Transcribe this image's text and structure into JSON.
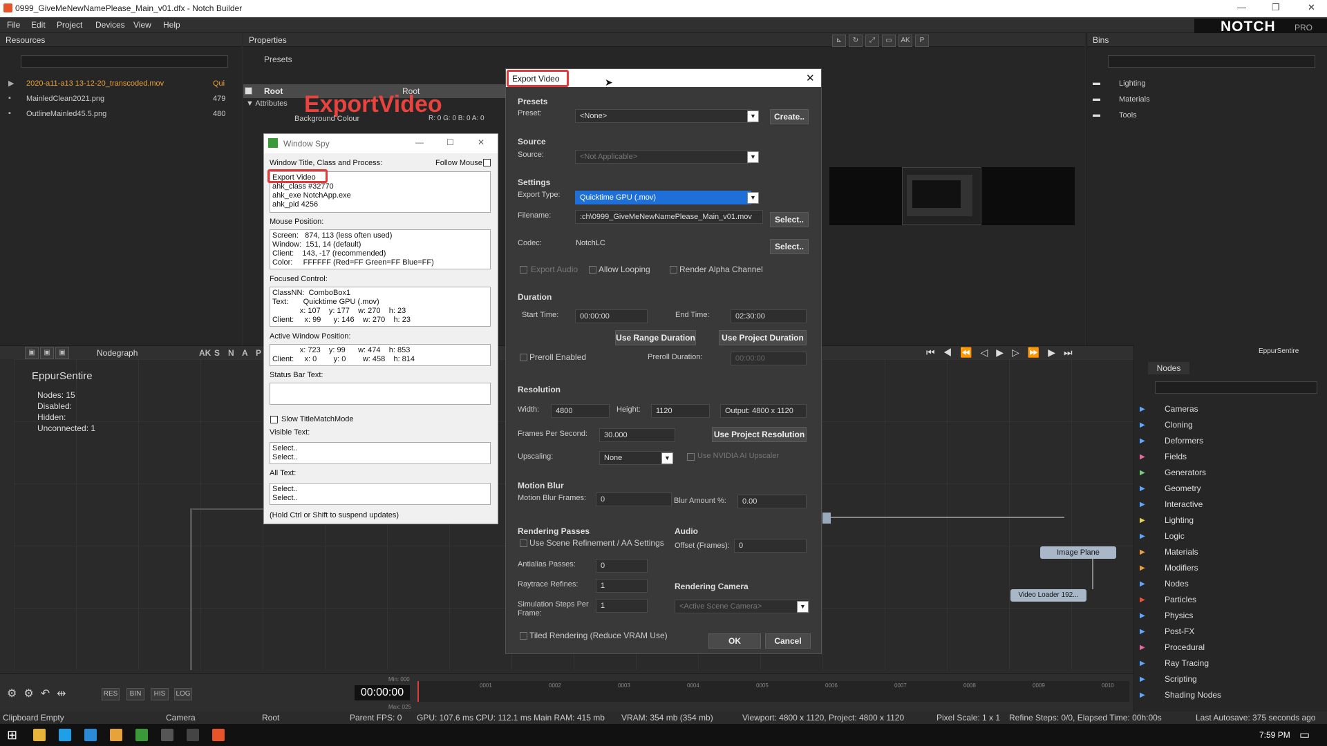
{
  "window": {
    "title": "0999_GiveMeNewNamePlease_Main_v01.dfx - Notch Builder"
  },
  "menu": [
    "File",
    "Edit",
    "Project",
    "Devices",
    "View",
    "Help"
  ],
  "logo": {
    "brand": "NOTCH",
    "edition": "PRO"
  },
  "resources": {
    "header": "Resources",
    "items": [
      {
        "name": "2020-a11-a13 13-12-20_transcoded.mov",
        "info": "Qui"
      },
      {
        "name": "MainledClean2021.png",
        "info": "479"
      },
      {
        "name": "OutlineMainled45.5.png",
        "info": "480"
      }
    ]
  },
  "properties": {
    "header": "Properties",
    "presets": "Presets",
    "root_label": "Root",
    "root_value": "Root",
    "attributes": "Attributes",
    "bg_colour": "Background Colour",
    "bg_value": "R: 0 G: 0 B: 0 A: 0"
  },
  "annotation": {
    "text": "ExportVideo"
  },
  "bins": {
    "header": "Bins",
    "items": [
      "Lighting",
      "Materials",
      "Tools"
    ]
  },
  "nodegraph": {
    "title": "Nodegraph",
    "toolbar": [
      "AK",
      "S",
      "N",
      "A",
      "P"
    ],
    "name": "EppurSentire",
    "nodes_label": "Nodes:",
    "nodes": "15",
    "disabled_label": "Disabled:",
    "hidden_label": "Hidden:",
    "unconnected_label": "Unconnected:",
    "unconnected": "1",
    "image_plane": "Image  Plane",
    "video_loader": "Video  Loader  192..."
  },
  "right_tabs": {
    "active": "Nodes",
    "name": "EppurSentire"
  },
  "categories": [
    "Cameras",
    "Cloning",
    "Deformers",
    "Fields",
    "Generators",
    "Geometry",
    "Interactive",
    "Lighting",
    "Logic",
    "Materials",
    "Modifiers",
    "Nodes",
    "Particles",
    "Physics",
    "Post-FX",
    "Procedural",
    "Ray Tracing",
    "Scripting",
    "Shading Nodes"
  ],
  "export": {
    "title": "Export Video",
    "presets_sec": "Presets",
    "preset_lbl": "Preset:",
    "preset_val": "<None>",
    "create_btn": "Create..",
    "source_sec": "Source",
    "source_lbl": "Source:",
    "source_val": "<Not Applicable>",
    "settings_sec": "Settings",
    "type_lbl": "Export Type:",
    "type_val": "Quicktime GPU (.mov)",
    "filename_lbl": "Filename:",
    "filename_val": ":ch\\0999_GiveMeNewNamePlease_Main_v01.mov",
    "select_btn": "Select..",
    "codec_lbl": "Codec:",
    "codec_val": "NotchLC",
    "codec_btn": "Select..",
    "export_audio": "Export Audio",
    "allow_looping": "Allow Looping",
    "render_alpha": "Render Alpha Channel",
    "duration_sec": "Duration",
    "start_lbl": "Start Time:",
    "start_val": "00:00:00",
    "end_lbl": "End Time:",
    "end_val": "02:30:00",
    "range_btn": "Use Range Duration",
    "project_btn": "Use Project Duration",
    "preroll": "Preroll Enabled",
    "preroll_dur_lbl": "Preroll Duration:",
    "preroll_dur_val": "00:00:00",
    "resolution_sec": "Resolution",
    "width_lbl": "Width:",
    "width_val": "4800",
    "height_lbl": "Height:",
    "height_val": "1120",
    "output": "Output: 4800 x 1120",
    "fps_lbl": "Frames Per Second:",
    "fps_val": "30.000",
    "proj_res_btn": "Use Project Resolution",
    "upscale_lbl": "Upscaling:",
    "upscale_val": "None",
    "nvidia": "Use NVIDIA AI Upscaler",
    "motion_sec": "Motion Blur",
    "mb_frames_lbl": "Motion Blur Frames:",
    "mb_frames_val": "0",
    "blur_amt_lbl": "Blur Amount %:",
    "blur_amt_val": "0.00",
    "passes_sec": "Rendering Passes",
    "scene_refine": "Use Scene Refinement / AA Settings",
    "aa_lbl": "Antialias Passes:",
    "aa_val": "0",
    "rt_lbl": "Raytrace Refines:",
    "rt_val": "1",
    "sim_lbl": "Simulation Steps Per",
    "sim_lbl2": "Frame:",
    "sim_val": "1",
    "tiled": "Tiled Rendering (Reduce VRAM Use)",
    "audio_sec": "Audio",
    "offset_lbl": "Offset (Frames):",
    "offset_val": "0",
    "camera_sec": "Rendering Camera",
    "camera_val": "<Active Scene Camera>",
    "ok": "OK",
    "cancel": "Cancel"
  },
  "spy": {
    "title": "Window Spy",
    "wtcp": "Window Title, Class and Process:",
    "follow": "Follow Mouse",
    "title_box": "Export Video\nahk_class #32770\nahk_exe NotchApp.exe\nahk_pid 4256",
    "mouse_lbl": "Mouse Position:",
    "mouse_box": "Screen:   874, 113 (less often used)\nWindow:  151, 14 (default)\nClient:    143, -17 (recommended)\nColor:     FFFFFF (Red=FF Green=FF Blue=FF)",
    "focused_lbl": "Focused Control:",
    "focused_box": "ClassNN:  ComboBox1\nText:       Quicktime GPU (.mov)\n             x: 107    y: 177    w: 270    h: 23\nClient:     x: 99      y: 146    w: 270    h: 23",
    "active_lbl": "Active Window Position:",
    "active_box": "             x: 723    y: 99      w: 474    h: 853\nClient:     x: 0        y: 0        w: 458    h: 814",
    "statusbar_lbl": "Status Bar Text:",
    "slow": "Slow TitleMatchMode",
    "visible_lbl": "Visible Text:",
    "visible_box": "Select..\nSelect..",
    "all_lbl": "All Text:",
    "all_box": "Select..\nSelect..",
    "hint": "(Hold Ctrl or Shift to suspend updates)"
  },
  "timeline": {
    "time": "00:00:00",
    "min": "Min: 000",
    "max": "Max: 025",
    "ticks": [
      "0001",
      "0002",
      "0003",
      "0004",
      "0005",
      "0006",
      "0007",
      "0008",
      "0009",
      "0010"
    ],
    "buttons": [
      "RES",
      "BIN",
      "HIS",
      "LOG"
    ]
  },
  "status": {
    "clipboard": "Clipboard Empty",
    "camera": "Camera",
    "root": "Root",
    "parent": "Parent  FPS: 0",
    "gpu": "GPU: 107.6 ms  CPU: 112.1 ms  Main RAM: 415 mb",
    "vram": "VRAM: 354 mb (354 mb)",
    "viewport": "Viewport: 4800 x 1120, Project: 4800 x 1120",
    "pixel": "Pixel Scale: 1 x 1",
    "refine": "Refine Steps: 0/0, Elapsed Time: 00h:00s",
    "autosave": "Last Autosave: 375 seconds ago"
  },
  "taskbar": {
    "clock": "7:59 PM"
  }
}
